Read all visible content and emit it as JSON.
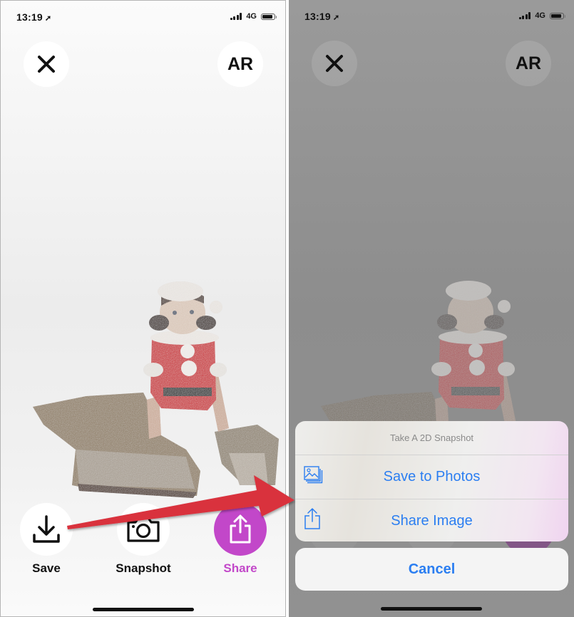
{
  "status_bar": {
    "time": "13:19",
    "location_icon": "location-arrow-icon",
    "network": "4G",
    "signal_bars": 4,
    "battery_level": 0.85
  },
  "left_screen": {
    "close_icon": "close-icon",
    "ar_label": "AR",
    "actions": [
      {
        "label": "Save",
        "icon": "download-icon"
      },
      {
        "label": "Snapshot",
        "icon": "camera-icon"
      },
      {
        "label": "Share",
        "icon": "share-icon"
      }
    ],
    "accent_color": "#c247c9"
  },
  "right_screen": {
    "ar_label": "AR",
    "action_sheet": {
      "title": "Take A 2D Snapshot",
      "items": [
        {
          "label": "Save to Photos",
          "icon": "photos-icon"
        },
        {
          "label": "Share Image",
          "icon": "share-icon"
        }
      ],
      "cancel_label": "Cancel",
      "tint_color": "#2b7ef1"
    }
  },
  "annotation": {
    "type": "arrow",
    "color": "#d9303e",
    "from": "save-button",
    "to": "action-sheet"
  }
}
